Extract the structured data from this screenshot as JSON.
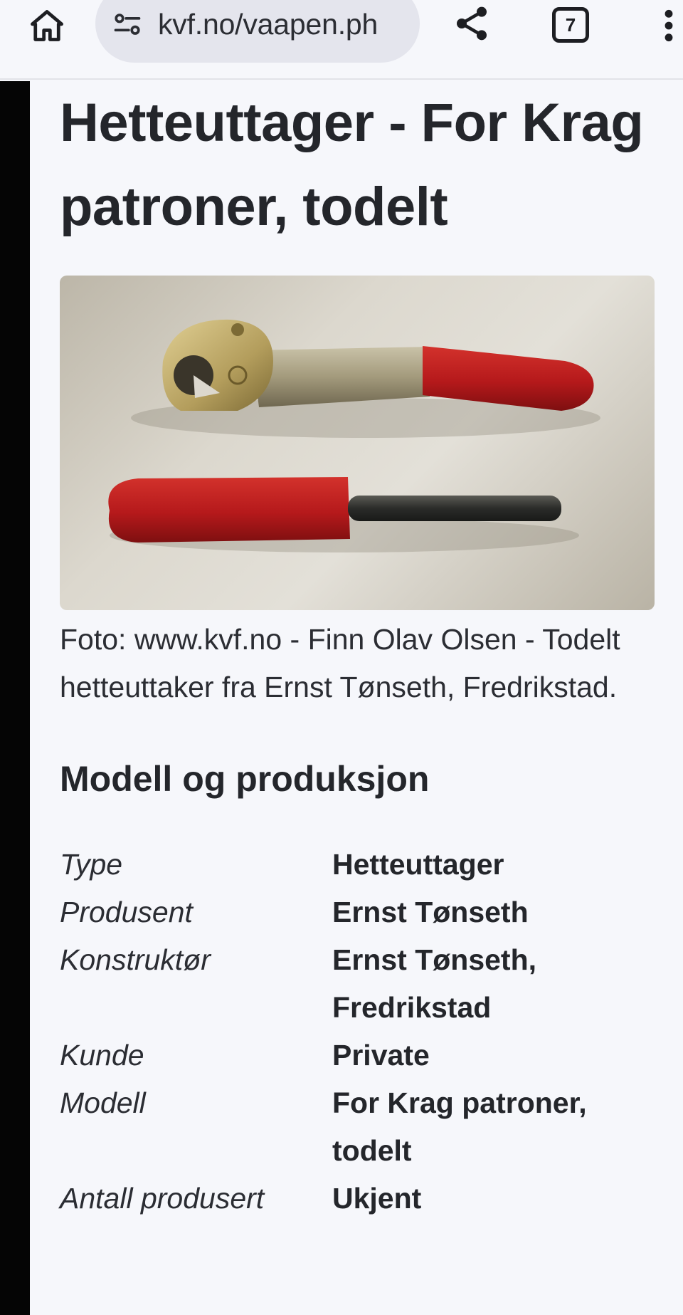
{
  "browser": {
    "url": "kvf.no/vaapen.ph",
    "tab_count": "7",
    "icons": {
      "home": "home-icon",
      "site_info": "site-settings-icon",
      "share": "share-icon",
      "tabs": "tab-switcher-icon",
      "menu": "more-vert-icon"
    }
  },
  "page": {
    "title": "Hetteuttager - For Krag patroner, todelt",
    "photo_alt": "Hetteuttager",
    "caption": "Foto: www.kvf.no - Finn Olav Olsen - Todelt hetteuttaker fra Ernst Tønseth, Fredrikstad.",
    "section_heading": "Modell og produksjon",
    "specs": [
      {
        "key": "Type",
        "value": "Hetteuttager"
      },
      {
        "key": "Produsent",
        "value": "Ernst Tønseth"
      },
      {
        "key": "Konstruktør",
        "value": "Ernst Tønseth, Fredrikstad"
      },
      {
        "key": "Kunde",
        "value": "Private"
      },
      {
        "key": "Modell",
        "value": "For Krag patroner, todelt"
      },
      {
        "key": "Antall produsert",
        "value": "Ukjent"
      }
    ]
  },
  "colors": {
    "background": "#f6f7fb",
    "urlbar": "#e4e5ed",
    "text": "#24262b",
    "handle_red": "#b5191b"
  }
}
